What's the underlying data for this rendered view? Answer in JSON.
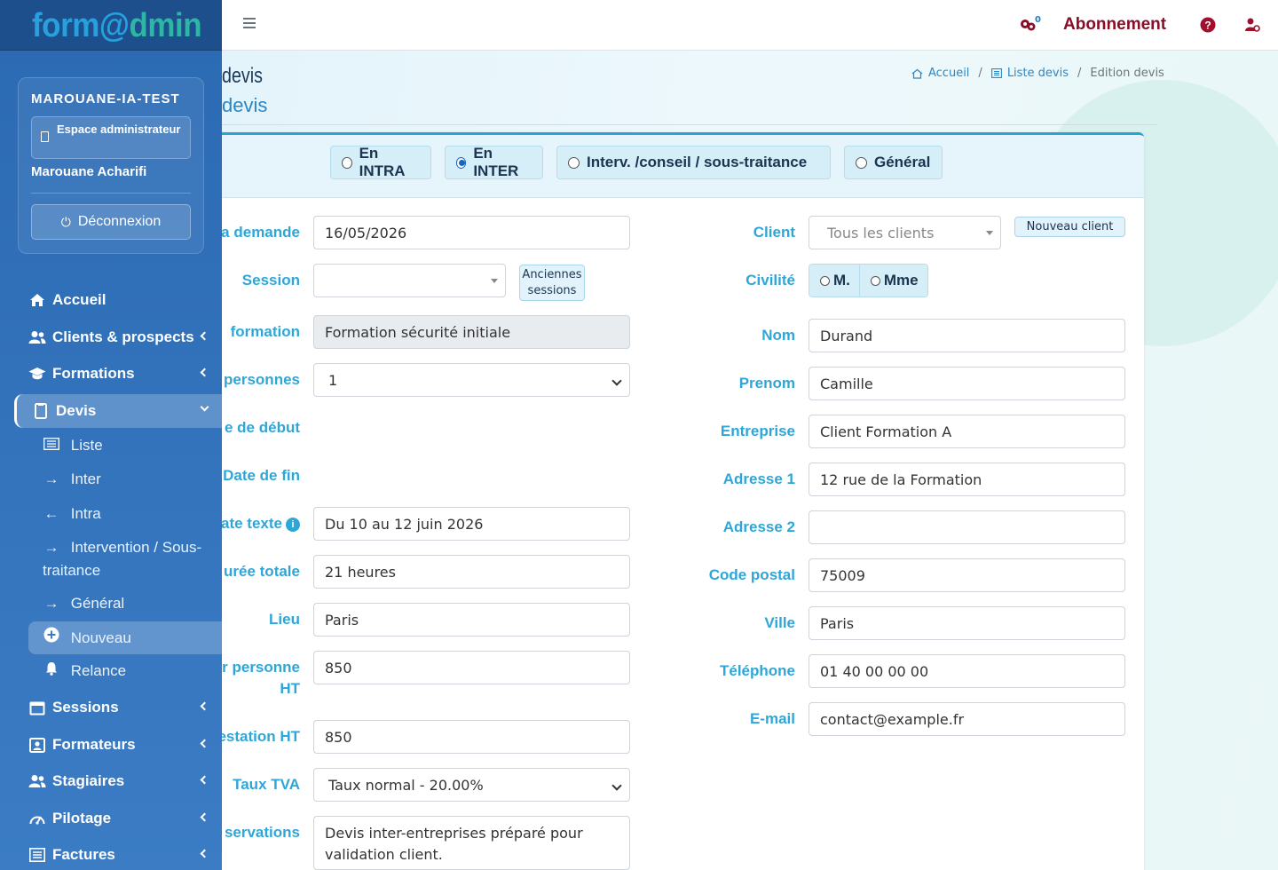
{
  "brand": {
    "part1": "form@",
    "part2": "dmin"
  },
  "user_panel": {
    "account": "MAROUANE-IA-TEST",
    "space_label": "Espace administrateur",
    "user_name": "Marouane Acharifi",
    "logout_label": "Déconnexion"
  },
  "nav": {
    "accueil": "Accueil",
    "clients": "Clients & prospects",
    "formations": "Formations",
    "devis": "Devis",
    "sessions": "Sessions",
    "formateurs": "Formateurs",
    "stagiaires": "Stagiaires",
    "pilotage": "Pilotage",
    "factures": "Factures",
    "devis_sub": {
      "liste": "Liste",
      "inter": "Inter",
      "intra": "Intra",
      "intervention": "Intervention / Sous-traitance",
      "general": "Général",
      "nouveau": "Nouveau",
      "relance": "Relance"
    }
  },
  "topbar": {
    "notif_count": "0",
    "abonnement": "Abonnement"
  },
  "header": {
    "title": "devis",
    "subtitle": "devis",
    "breadcrumb": [
      "Accueil",
      "Liste devis",
      "Edition devis"
    ]
  },
  "devis_type": {
    "options": [
      "En INTRA",
      "En INTER",
      "Interv. /conseil / sous-traitance",
      "Général"
    ],
    "selected": "En INTER"
  },
  "form_left": {
    "date_demande": {
      "label": "la demande",
      "value": "16/05/2026"
    },
    "session": {
      "label": "Session",
      "value": "",
      "old_sessions_button": "Anciennes sessions"
    },
    "formation": {
      "label": "formation",
      "value": "Formation sécurité initiale"
    },
    "personnes": {
      "label": "personnes",
      "value": "1"
    },
    "date_debut": {
      "label": "e de début"
    },
    "date_fin": {
      "label": "Date de fin"
    },
    "date_texte": {
      "label": "ate texte",
      "value": "Du 10 au 12 juin 2026"
    },
    "duree": {
      "label": "urée totale",
      "value": "21 heures"
    },
    "lieu": {
      "label": "Lieu",
      "value": "Paris"
    },
    "prix_personne": {
      "label_line1": "r personne",
      "label_line2": "HT",
      "value": "850"
    },
    "prestation": {
      "label": "estation HT",
      "value": "850"
    },
    "tva": {
      "label": "Taux TVA",
      "value": "Taux normal - 20.00%"
    },
    "observations": {
      "label": "servations",
      "value": "Devis inter-entreprises préparé pour validation client."
    }
  },
  "form_right": {
    "client": {
      "label": "Client",
      "placeholder": "Tous les clients",
      "new_button": "Nouveau client"
    },
    "civilite": {
      "label": "Civilité",
      "options": [
        "M.",
        "Mme"
      ]
    },
    "nom": {
      "label": "Nom",
      "value": "Durand"
    },
    "prenom": {
      "label": "Prenom",
      "value": "Camille"
    },
    "entreprise": {
      "label": "Entreprise",
      "value": "Client Formation A"
    },
    "adresse1": {
      "label": "Adresse 1",
      "value": "12 rue de la Formation"
    },
    "adresse2": {
      "label": "Adresse 2",
      "value": ""
    },
    "code_postal": {
      "label": "Code postal",
      "value": "75009"
    },
    "ville": {
      "label": "Ville",
      "value": "Paris"
    },
    "telephone": {
      "label": "Téléphone",
      "value": "01 40 00 00 00"
    },
    "email": {
      "label": "E-mail",
      "value": "contact@example.fr"
    }
  },
  "colors": {
    "sidebar": "#2b6ab3",
    "accent": "#2fa6d8",
    "abonnement": "#8a0d27"
  }
}
